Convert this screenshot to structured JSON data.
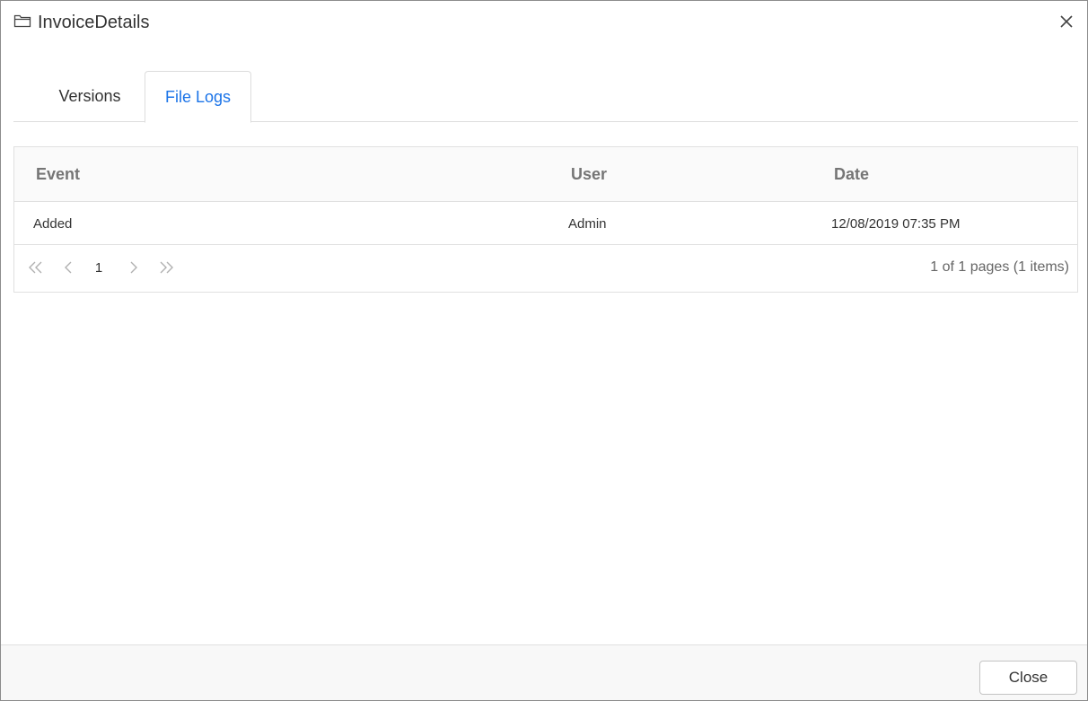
{
  "dialog": {
    "title": "InvoiceDetails",
    "icons": {
      "title_icon": "folder-icon",
      "close_icon": "close-icon"
    }
  },
  "tabs": [
    {
      "label": "Versions",
      "active": false
    },
    {
      "label": "File Logs",
      "active": true
    }
  ],
  "grid": {
    "columns": [
      "Event",
      "User",
      "Date"
    ],
    "rows": [
      {
        "event": "Added",
        "user": "Admin",
        "date": "12/08/2019 07:35 PM"
      }
    ]
  },
  "pager": {
    "current_page": "1",
    "info": "1 of 1 pages (1 items)",
    "icons": [
      "first-page-icon",
      "previous-page-icon",
      "next-page-icon",
      "last-page-icon"
    ]
  },
  "footer": {
    "close_label": "Close"
  },
  "colors": {
    "accent": "#1a73e8",
    "header_text": "#757575",
    "border": "#e0e0e0",
    "footer_bg": "#f8f8f8"
  }
}
